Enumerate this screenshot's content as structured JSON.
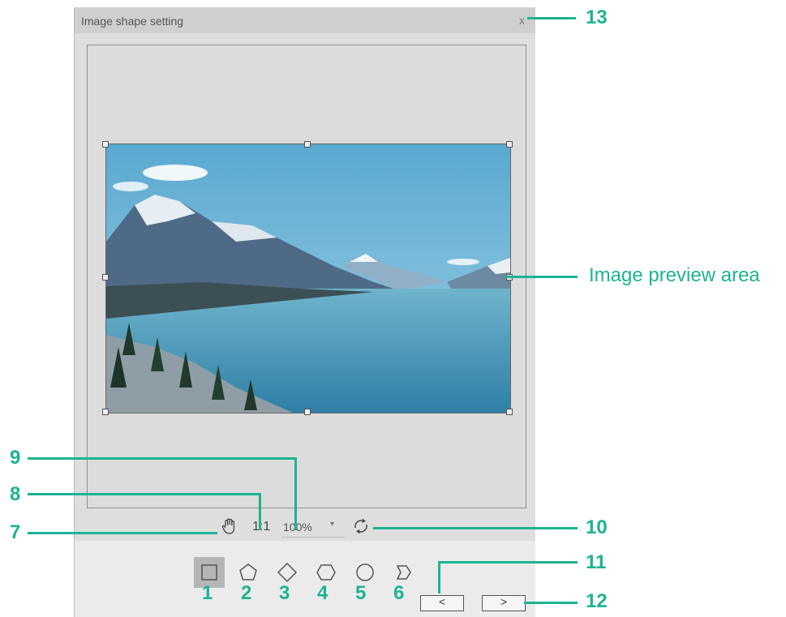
{
  "dialog": {
    "title": "Image shape setting",
    "close_label": "x"
  },
  "zoom": {
    "ratio_label": "1:1",
    "value": "100%"
  },
  "icons": {
    "hand": "hand-icon",
    "rotate": "rotate-icon",
    "shapes": [
      "square-icon",
      "pentagon-icon",
      "diamond-icon",
      "hexagon-icon",
      "circle-icon",
      "chevron-icon"
    ]
  },
  "nav": {
    "prev_label": "<",
    "next_label": ">"
  },
  "callouts": {
    "preview_label": "Image preview area",
    "n1": "1",
    "n2": "2",
    "n3": "3",
    "n4": "4",
    "n5": "5",
    "n6": "6",
    "n7": "7",
    "n8": "8",
    "n9": "9",
    "n10": "10",
    "n11": "11",
    "n12": "12",
    "n13": "13"
  },
  "colors": {
    "callout": "#1db394",
    "dialog_bg": "#dedede",
    "titlebar_bg": "#cfcfcf"
  }
}
